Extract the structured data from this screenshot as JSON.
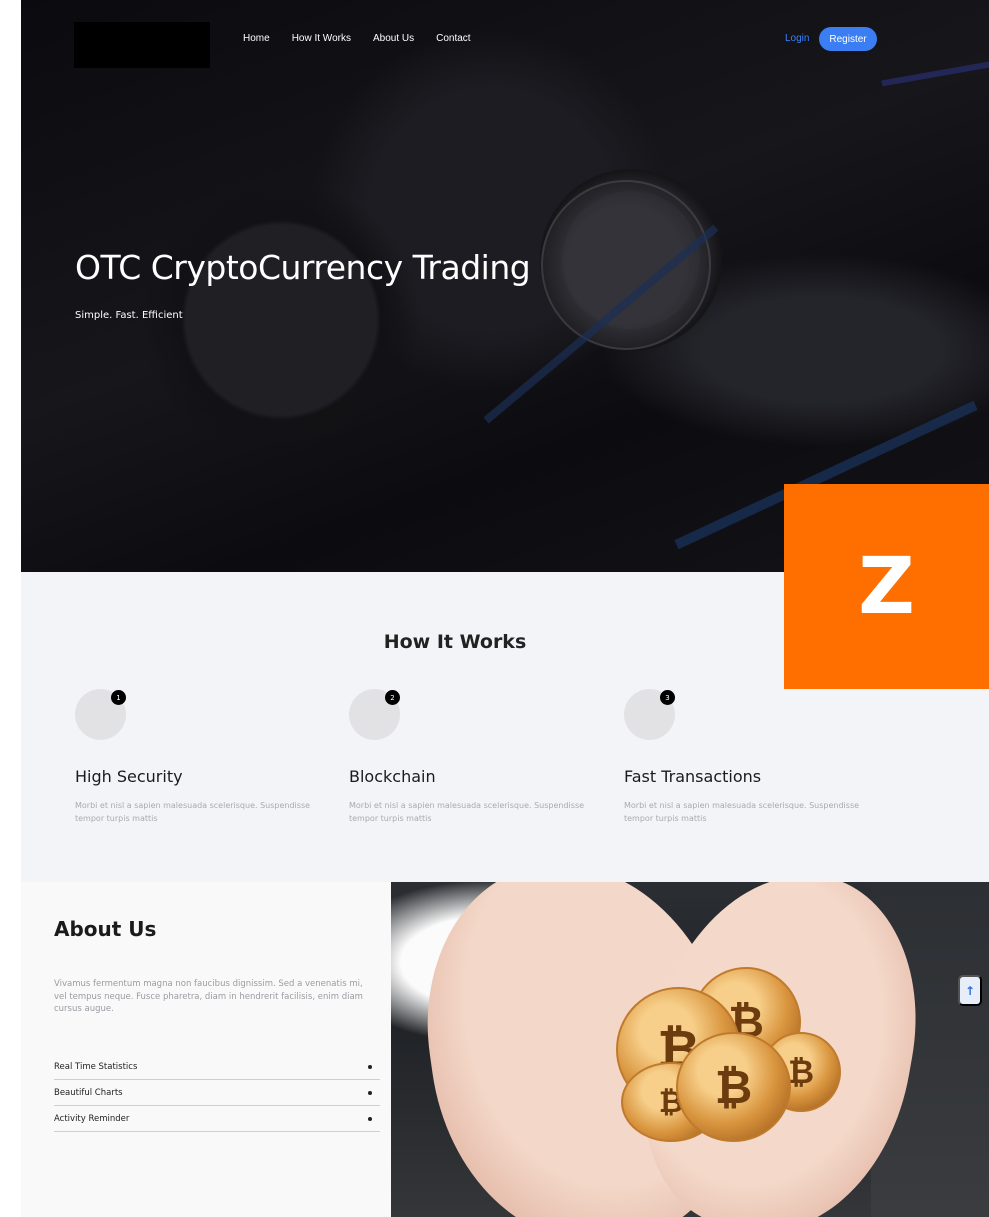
{
  "nav": {
    "items": [
      "Home",
      "How It Works",
      "About Us",
      "Contact"
    ],
    "login": "Login",
    "register": "Register"
  },
  "hero": {
    "title": "OTC CryptoCurrency Trading",
    "subtitle": "Simple. Fast. Efficient"
  },
  "badge": {
    "letter": "Z"
  },
  "how_it_works": {
    "title": "How It Works",
    "steps": [
      {
        "number": "1",
        "title": "High Security",
        "text": "Morbi et nisl a sapien malesuada scelerisque. Suspendisse tempor turpis mattis"
      },
      {
        "number": "2",
        "title": "Blockchain",
        "text": "Morbi et nisl a sapien malesuada scelerisque. Suspendisse tempor turpis mattis"
      },
      {
        "number": "3",
        "title": "Fast Transactions",
        "text": "Morbi et nisl a sapien malesuada scelerisque. Suspendisse tempor turpis mattis"
      }
    ]
  },
  "about": {
    "title": "About Us",
    "text": "Vivamus fermentum magna non faucibus dignissim. Sed a venenatis mi, vel tempus neque. Fusce pharetra, diam in hendrerit facilisis, enim diam cursus augue.",
    "features": [
      "Real Time Statistics",
      "Beautiful Charts",
      "Activity Reminder"
    ]
  },
  "scroll_top": {
    "icon": "arrow-up-icon"
  },
  "colors": {
    "accent": "#3b7df2",
    "badge": "#ff6f00",
    "section_bg": "#f3f4f8"
  }
}
